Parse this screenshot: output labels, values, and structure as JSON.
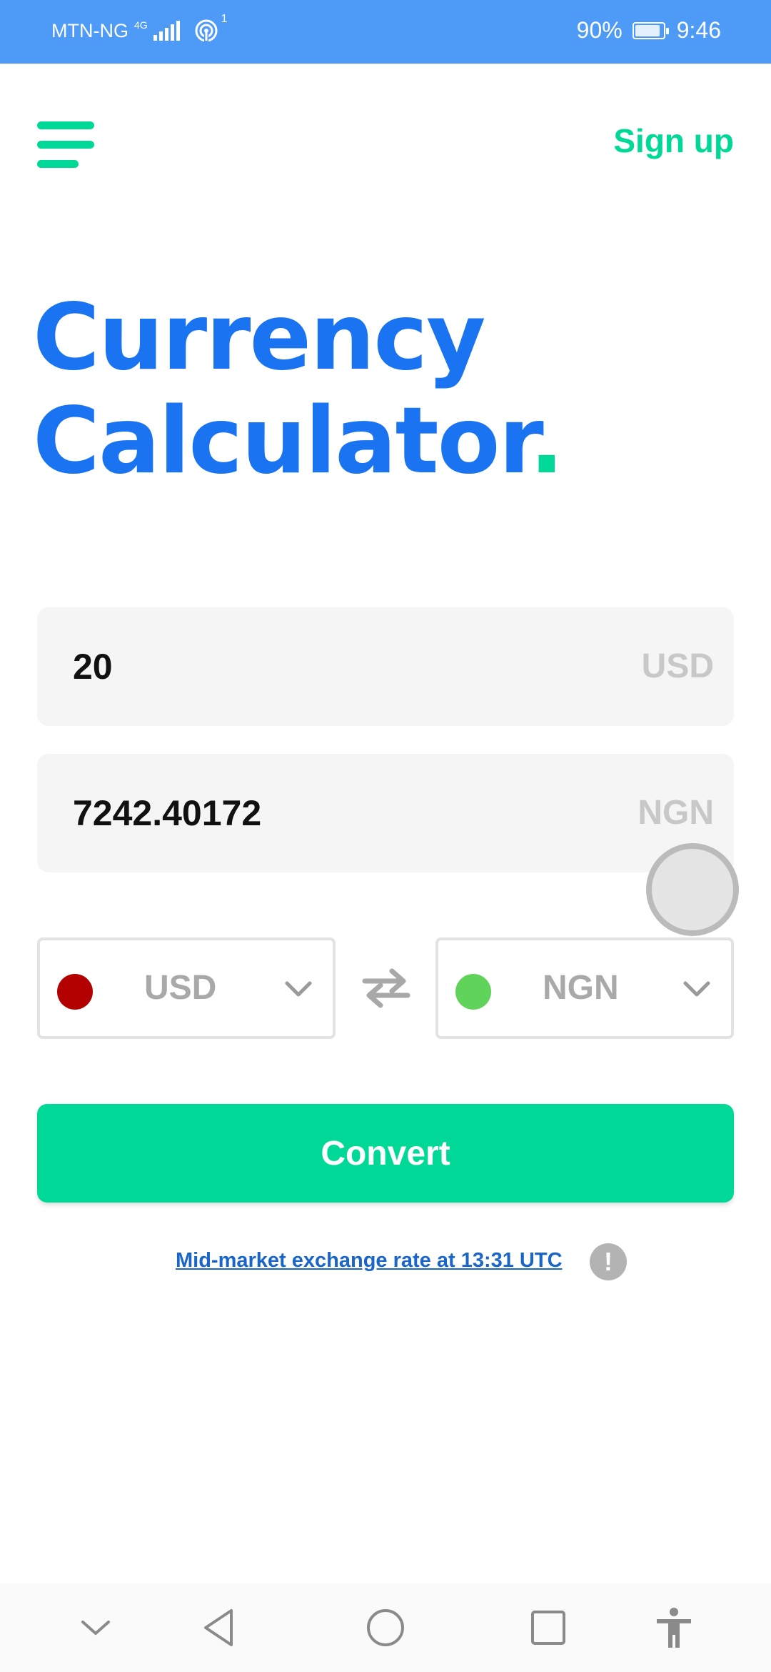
{
  "status_bar": {
    "carrier": "MTN-NG",
    "network_type": "4G",
    "hotspot_count": "1",
    "battery_percent": "90%",
    "battery_level": 0.9,
    "time": "9:46"
  },
  "header": {
    "menu_icon": "hamburger-menu-icon",
    "signup_label": "Sign up"
  },
  "title": {
    "line1": "Currency",
    "line2": "Calculator",
    "dot": "."
  },
  "converter": {
    "from_amount": "20",
    "from_code": "USD",
    "to_amount": "7242.40172",
    "to_code": "NGN",
    "from_select": {
      "code": "USD",
      "flag_color": "#b30000"
    },
    "to_select": {
      "code": "NGN",
      "flag_color": "#5fd35a"
    },
    "swap_icon": "swap-arrows-icon",
    "convert_label": "Convert"
  },
  "rate_info": {
    "link_text": "Mid-market exchange rate at 13:31 UTC",
    "info_symbol": "!"
  },
  "colors": {
    "accent_green": "#00d897",
    "title_blue": "#1a73f0",
    "status_bar_blue": "#4d9bf7",
    "link_blue": "#1a66c8"
  },
  "nav_bar": {
    "icons": [
      "collapse-chevron-icon",
      "back-icon",
      "home-icon",
      "recents-icon",
      "accessibility-icon"
    ]
  }
}
